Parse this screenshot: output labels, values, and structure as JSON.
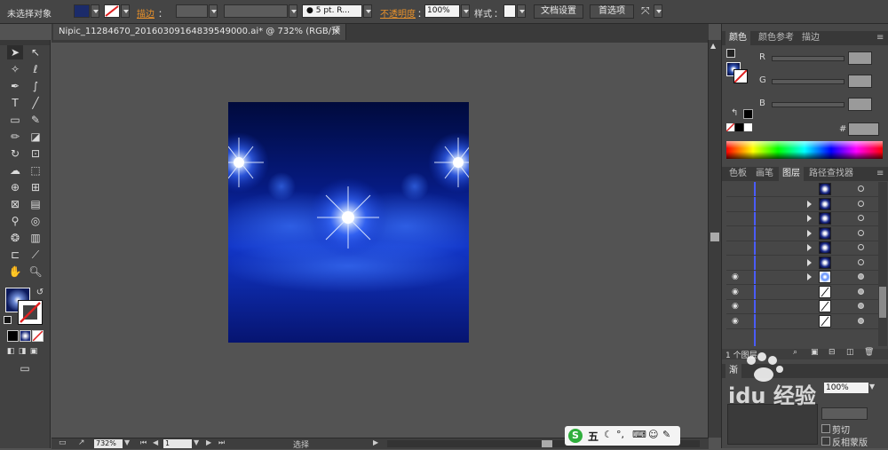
{
  "control_bar": {
    "selection_label": "未选择对象",
    "stroke_label": "描边",
    "stroke_colon": "：",
    "brush_value": "5 pt. R...",
    "opacity_label": "不透明度",
    "opacity_colon": "：",
    "opacity_value": "100%",
    "style_label": "样式",
    "style_colon": "：",
    "doc_setup_button": "文档设置",
    "preferences_button": "首选项",
    "accent_color": "#e8912b"
  },
  "document": {
    "tab_title": "Nipic_11284670_20160309164839549000.ai* @ 732% (RGB/预览)",
    "close_glyph": "×"
  },
  "status_bar": {
    "zoom_value": "732%",
    "artboard_value": "1",
    "tool_name": "选择"
  },
  "color_panel": {
    "tabs": [
      "颜色",
      "颜色参考",
      "描边"
    ],
    "channels": [
      "R",
      "G",
      "B"
    ],
    "hex_label": "#"
  },
  "layers_panel": {
    "tabs": [
      "色板",
      "画笔",
      "图层",
      "路径查找器"
    ],
    "layer_count_text": "1 个图层",
    "rows": [
      {
        "visible": false,
        "expand": false,
        "thumb": "sphere",
        "target": "empty"
      },
      {
        "visible": false,
        "expand": true,
        "thumb": "sphere",
        "target": "empty"
      },
      {
        "visible": false,
        "expand": true,
        "thumb": "sphere",
        "target": "empty"
      },
      {
        "visible": false,
        "expand": true,
        "thumb": "sphere",
        "target": "empty"
      },
      {
        "visible": false,
        "expand": true,
        "thumb": "sphere",
        "target": "empty"
      },
      {
        "visible": false,
        "expand": true,
        "thumb": "sphere",
        "target": "empty"
      },
      {
        "visible": true,
        "expand": true,
        "thumb": "spark",
        "target": "filled"
      },
      {
        "visible": true,
        "expand": false,
        "thumb": "line",
        "target": "filled"
      },
      {
        "visible": true,
        "expand": false,
        "thumb": "line",
        "target": "filled"
      },
      {
        "visible": true,
        "expand": false,
        "thumb": "line",
        "target": "filled"
      }
    ]
  },
  "lower_panel": {
    "tab_partial": "渐",
    "opacity_value": "100%",
    "clip_label": "剪切",
    "invert_mask_label": "反相蒙版"
  },
  "ime_bar": {
    "logo": "S",
    "mode": "五"
  },
  "watermark": {
    "text": "idu 经验"
  }
}
